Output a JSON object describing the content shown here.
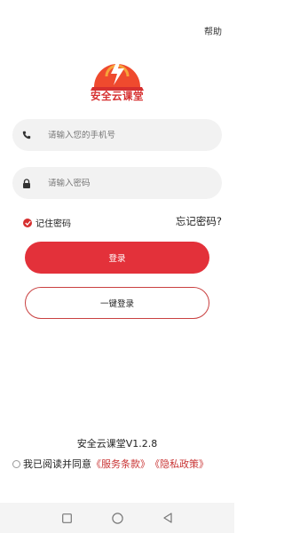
{
  "header": {
    "help_label": "帮助"
  },
  "brand": {
    "name": "安全云课堂",
    "color": "#d62f2f"
  },
  "form": {
    "phone": {
      "placeholder": "请输入您的手机号",
      "value": "",
      "icon": "phone-icon"
    },
    "password": {
      "placeholder": "请输入密码",
      "value": "",
      "icon": "lock-icon"
    },
    "remember": {
      "label": "记住密码",
      "checked": true
    },
    "forgot_label": "忘记密码?"
  },
  "actions": {
    "login_label": "登录",
    "one_key_login_label": "一键登录",
    "accent": "#e3313a"
  },
  "footer": {
    "version": "安全云课堂V1.2.8",
    "agreement": {
      "checked": false,
      "prefix": "我已阅读并同意",
      "terms_link": "《服务条款》",
      "privacy_link": "《隐私政策》"
    }
  },
  "system_nav": {
    "icons": [
      "square-icon",
      "circle-icon",
      "back-triangle-icon"
    ]
  }
}
